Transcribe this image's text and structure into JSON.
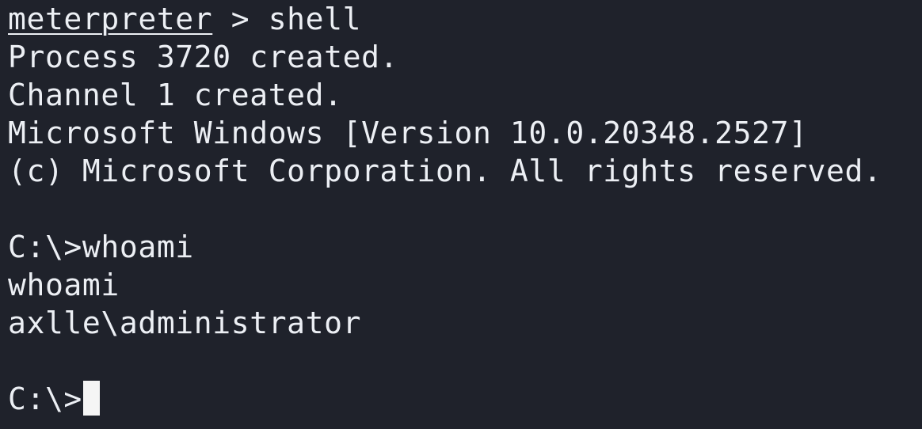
{
  "terminal": {
    "prompt_name": "meterpreter",
    "prompt_sep": " > ",
    "command_1": "shell",
    "line_2": "Process 3720 created.",
    "line_3": "Channel 1 created.",
    "line_4": "Microsoft Windows [Version 10.0.20348.2527]",
    "line_5": "(c) Microsoft Corporation. All rights reserved.",
    "line_7": "C:\\>whoami",
    "line_8": "whoami",
    "line_9": "axlle\\administrator",
    "prompt_final": "C:\\>",
    "colors": {
      "background": "#1f222b",
      "foreground": "#eceff4",
      "cursor": "#f5f5f5"
    }
  }
}
